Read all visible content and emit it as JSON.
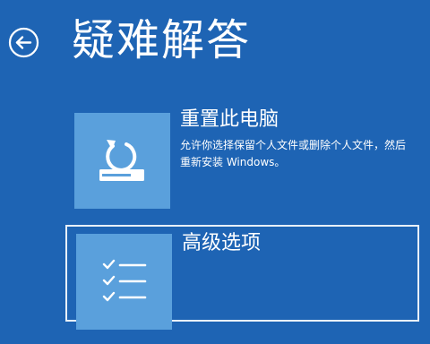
{
  "header": {
    "back_icon": "arrow-left-circle-icon",
    "title": "疑难解答"
  },
  "options": [
    {
      "icon": "reset-pc-icon",
      "title": "重置此电脑",
      "description": "允许你选择保留个人文件或删除个人文件，然后重新安装 Windows。"
    },
    {
      "icon": "checklist-icon",
      "title": "高级选项"
    }
  ],
  "colors": {
    "background": "#1e64b4",
    "tile": "#5aa0dc",
    "text": "#ffffff"
  }
}
